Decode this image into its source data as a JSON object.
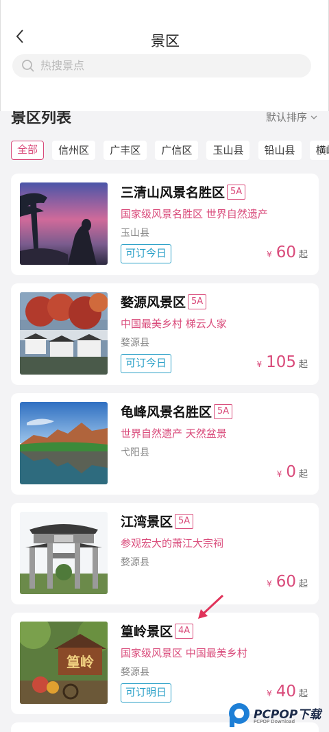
{
  "header": {
    "title": "景区",
    "search_placeholder": "热搜景点"
  },
  "list": {
    "title": "景区列表",
    "sort_label": "默认排序"
  },
  "filters": [
    "全部",
    "信州区",
    "广丰区",
    "广信区",
    "玉山县",
    "铅山县",
    "横峰县"
  ],
  "active_filter": "全部",
  "spots": [
    {
      "name": "三清山风景名胜区",
      "grade": "5A",
      "tagline": "国家级风景名胜区 世界自然遗产",
      "county": "玉山县",
      "booking": "可订今日",
      "currency": "¥",
      "price": "60",
      "suffix": "起"
    },
    {
      "name": "婺源风景区",
      "grade": "5A",
      "tagline": "中国最美乡村 梯云人家",
      "county": "婺源县",
      "booking": "可订今日",
      "currency": "¥",
      "price": "105",
      "suffix": "起"
    },
    {
      "name": "龟峰风景名胜区",
      "grade": "5A",
      "tagline": "世界自然遗产 天然盆景",
      "county": "弋阳县",
      "booking": "",
      "currency": "¥",
      "price": "0",
      "suffix": "起"
    },
    {
      "name": "江湾景区",
      "grade": "5A",
      "tagline": "参观宏大的萧江大宗祠",
      "county": "婺源县",
      "booking": "",
      "currency": "¥",
      "price": "60",
      "suffix": "起"
    },
    {
      "name": "篁岭景区",
      "grade": "4A",
      "tagline": "国家级风景区 中国最美乡村",
      "county": "婺源县",
      "booking": "可订明日",
      "currency": "¥",
      "price": "40",
      "suffix": "起"
    }
  ],
  "thumb_sign_text": "篁岭",
  "watermark": {
    "brand": "PCPOP下载",
    "sub": "PCPOP Download"
  },
  "colors": {
    "accent": "#d94a7a",
    "booking": "#2aa0c7",
    "background": "#f3f3f5"
  }
}
